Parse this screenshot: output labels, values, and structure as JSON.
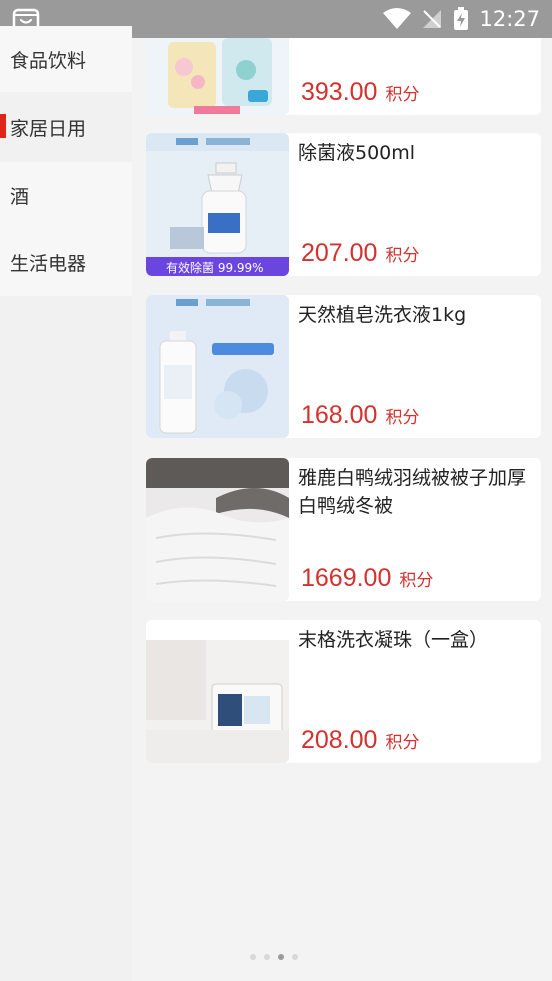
{
  "status_bar": {
    "time": "12:27"
  },
  "sidebar": {
    "items": [
      {
        "label": "食品饮料"
      },
      {
        "label": "家居日用"
      },
      {
        "label": "酒"
      },
      {
        "label": "生活电器"
      }
    ],
    "active_index": 1
  },
  "products": [
    {
      "title": "",
      "price": "393.00",
      "unit": "积分"
    },
    {
      "title": "除菌液500ml",
      "price": "207.00",
      "unit": "积分",
      "image_caption": "有效除菌 99.99%"
    },
    {
      "title": "天然植皂洗衣液1kg",
      "price": "168.00",
      "unit": "积分"
    },
    {
      "title": "雅鹿白鸭绒羽绒被被子加厚白鸭绒冬被",
      "price": "1669.00",
      "unit": "积分"
    },
    {
      "title": "末格洗衣凝珠（一盒）",
      "price": "208.00",
      "unit": "积分"
    }
  ],
  "colors": {
    "accent": "#d4312e",
    "statusbar": "#9a9a9a"
  }
}
